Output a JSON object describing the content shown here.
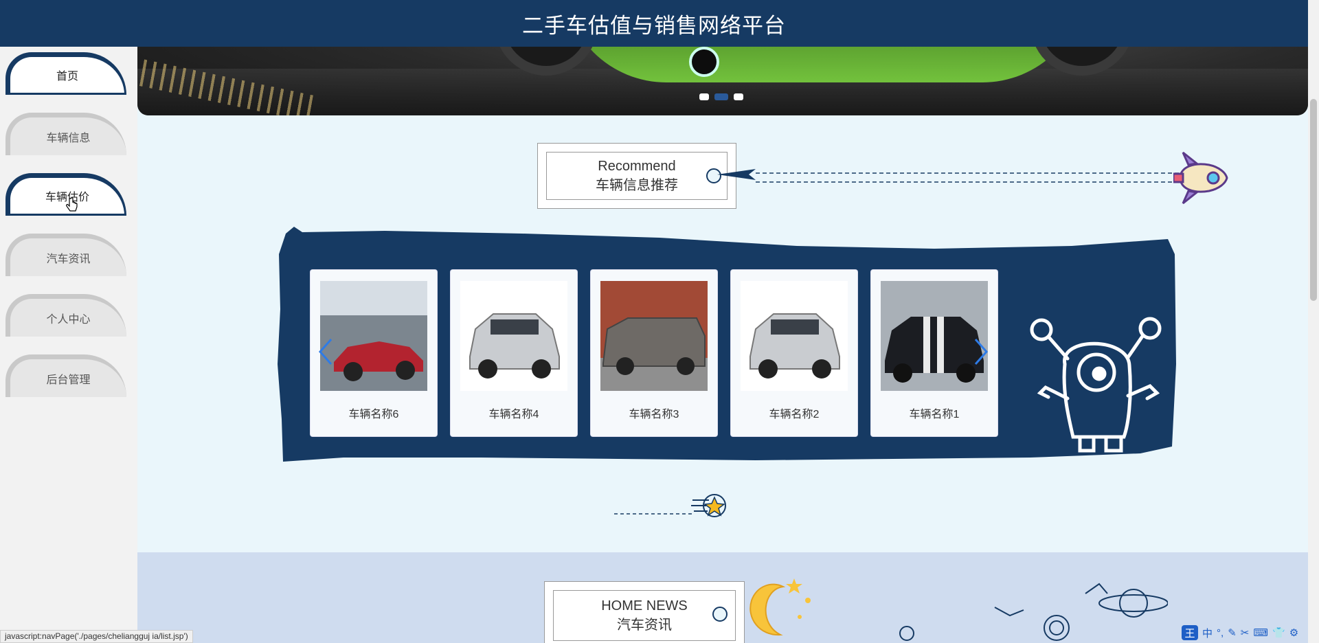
{
  "header": {
    "title": "二手车估值与销售网络平台"
  },
  "sidebar": {
    "items": [
      {
        "label": "首页",
        "active": true
      },
      {
        "label": "车辆信息",
        "active": false
      },
      {
        "label": "车辆估价",
        "active": true
      },
      {
        "label": "汽车资讯",
        "active": false
      },
      {
        "label": "个人中心",
        "active": false
      },
      {
        "label": "后台管理",
        "active": false
      }
    ]
  },
  "recommend": {
    "title_en": "Recommend",
    "title_cn": "车辆信息推荐"
  },
  "cars": [
    {
      "name": "车辆名称6"
    },
    {
      "name": "车辆名称4"
    },
    {
      "name": "车辆名称3"
    },
    {
      "name": "车辆名称2"
    },
    {
      "name": "车辆名称1"
    }
  ],
  "news": {
    "title_en": "HOME NEWS",
    "title_cn": "汽车资讯"
  },
  "status_bar": {
    "text": "javascript:navPage('./pages/cheliangguj ia/list.jsp')"
  },
  "ime": {
    "items": [
      "中",
      "°,",
      "✎",
      "✂",
      "⌨",
      "👕",
      "⚙"
    ]
  },
  "colors": {
    "primary": "#163a63",
    "background": "#eaf6fb",
    "news_bg": "#cfdcef"
  }
}
